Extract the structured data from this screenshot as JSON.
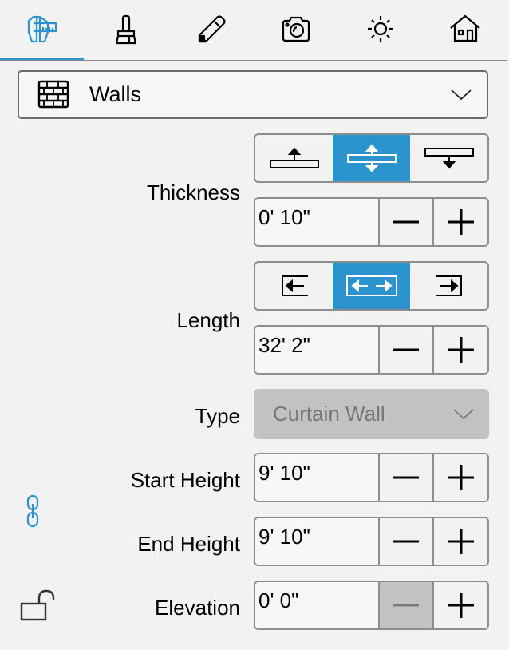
{
  "tabs": [
    {
      "name": "dimensions",
      "icon": "caliper-ruler-icon",
      "active": true
    },
    {
      "name": "materials",
      "icon": "brush-icon",
      "active": false
    },
    {
      "name": "edit",
      "icon": "pencil-icon",
      "active": false
    },
    {
      "name": "camera",
      "icon": "camera-icon",
      "active": false
    },
    {
      "name": "lighting",
      "icon": "sun-icon",
      "active": false
    },
    {
      "name": "building",
      "icon": "house-icon",
      "active": false
    }
  ],
  "category": {
    "label": "Walls",
    "icon": "brick-wall-icon"
  },
  "colors": {
    "accent": "#2b93cd",
    "disabled": "#c2c2c2",
    "background": "#f2f2f2"
  },
  "thickness": {
    "label": "Thickness",
    "alignment_options": [
      "exterior",
      "center",
      "interior"
    ],
    "selected_alignment": "center",
    "value": "0' 10\""
  },
  "length": {
    "label": "Length",
    "anchor_options": [
      "start",
      "center",
      "end"
    ],
    "selected_anchor": "center",
    "value": "32' 2\""
  },
  "type": {
    "label": "Type",
    "value": "Curtain Wall",
    "disabled": true
  },
  "start_height": {
    "label": "Start Height",
    "value": "9' 10\""
  },
  "end_height": {
    "label": "End Height",
    "value": "9' 10\""
  },
  "elevation": {
    "label": "Elevation",
    "value": "0' 0\"",
    "minus_disabled": true
  },
  "height_link": {
    "icon": "link-icon",
    "linked": true
  },
  "elevation_lock": {
    "icon": "unlock-icon",
    "locked": false
  }
}
